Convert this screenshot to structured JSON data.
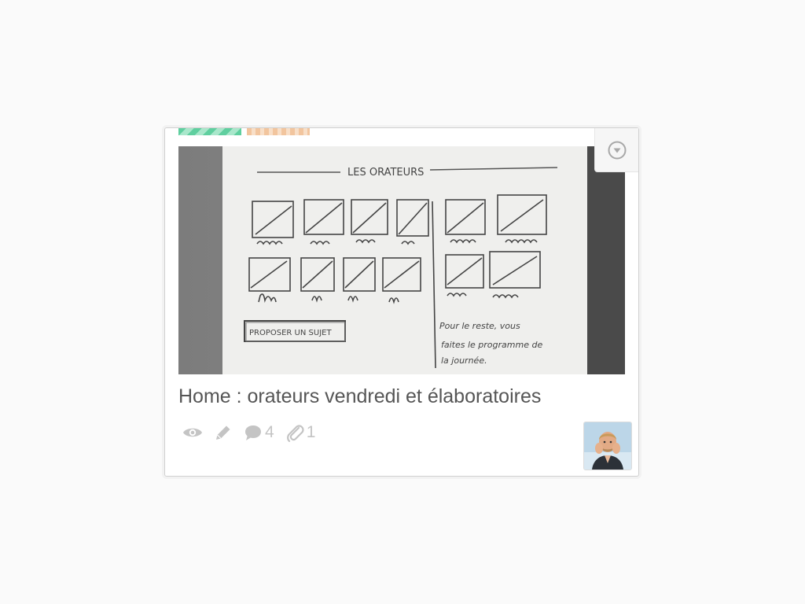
{
  "card": {
    "title": "Home : orateurs vendredi et élaboratoires",
    "labels": [
      {
        "name": "label-green",
        "color": "#5fcf9f"
      },
      {
        "name": "label-orange",
        "color": "#f2c59e"
      }
    ],
    "menu_icon": "chevron-down-circle-icon",
    "cover": {
      "heading": "LES ORATEURS",
      "button_text": "PROPOSER UN SUJET",
      "note": [
        "Pour le reste, vous",
        "faites le programme de",
        "la journée."
      ]
    },
    "badges": {
      "view_icon": "eye-icon",
      "edit_icon": "pencil-icon",
      "comments_icon": "comment-icon",
      "comments_count": "4",
      "attachments_icon": "paperclip-icon",
      "attachments_count": "1"
    },
    "member_avatar": "avatar"
  },
  "colors": {
    "page_bg": "#fafafa",
    "title_text": "#555555",
    "badge_icon": "#c4c4c4"
  }
}
